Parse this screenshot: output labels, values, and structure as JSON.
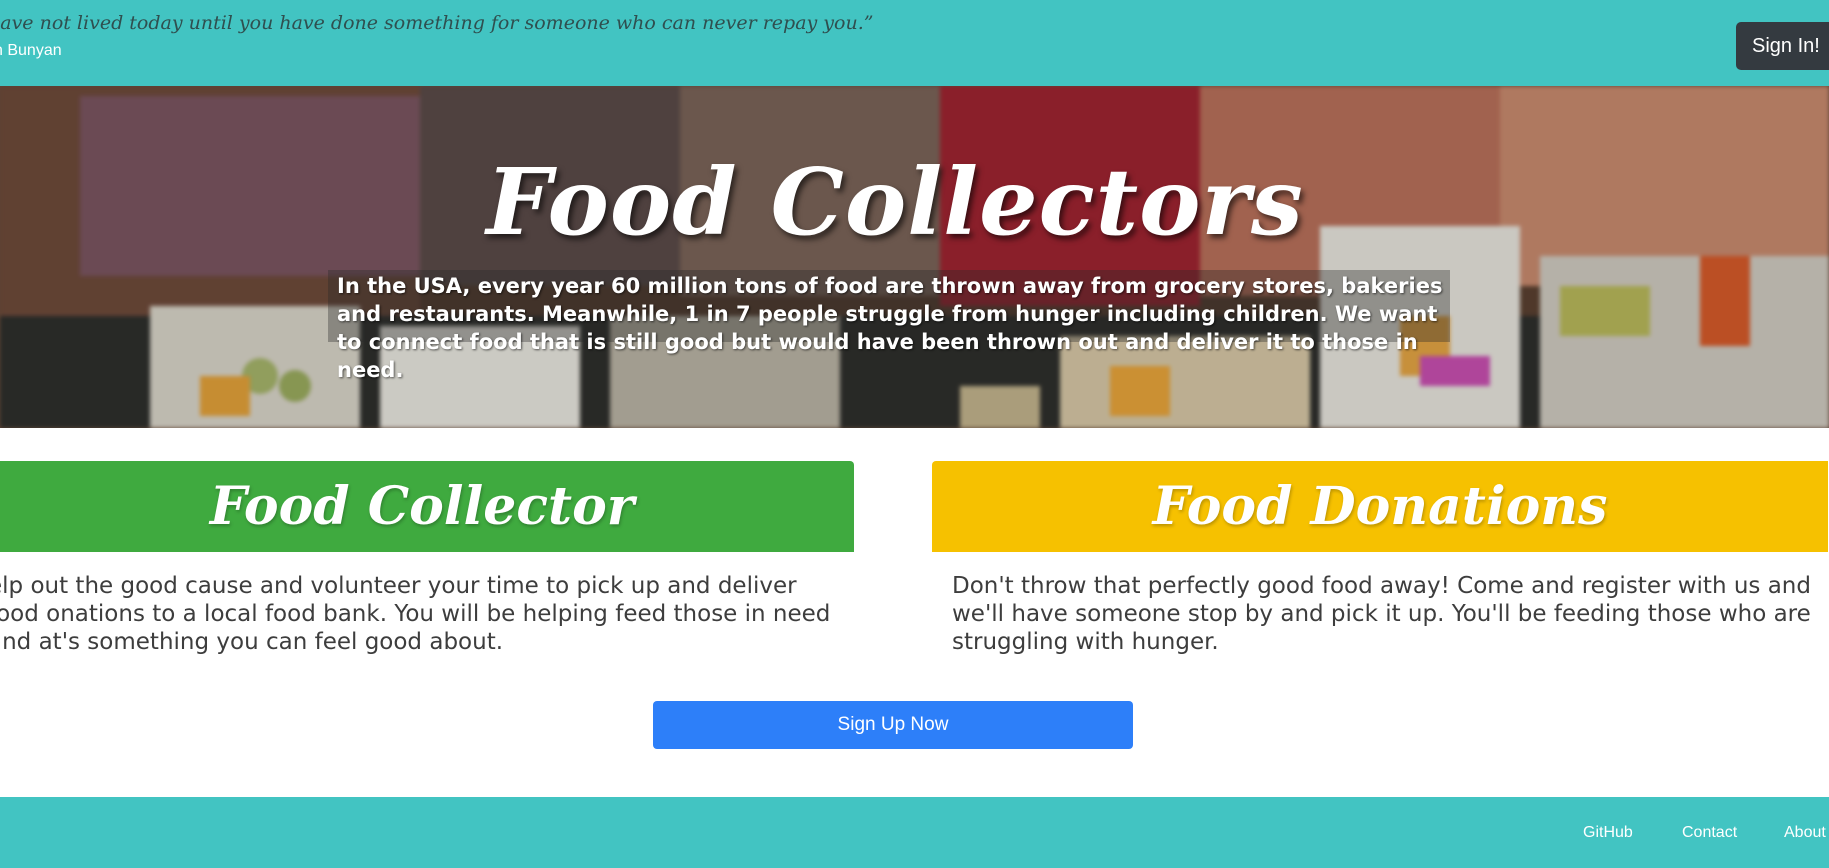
{
  "header": {
    "quote": "have not lived today until you have done something for someone who can never repay you.”",
    "quote_author": "n Bunyan",
    "signin_label": "Sign In!"
  },
  "hero": {
    "title": "Food Collectors",
    "description": "In the USA, every year 60 million tons of food are thrown away from grocery stores, bakeries and restaurants. Meanwhile, 1 in 7 people struggle from hunger including children. We want to connect food that is still good but would have been thrown out and deliver it to those in need.",
    "background_image": "children-eating-lunch-photo"
  },
  "cards": [
    {
      "title": "Food Collector",
      "body": "elp out the good cause and volunteer your time to pick up and deliver food onations to a local food bank. You will be helping feed those in need and at's something you can feel good about.",
      "color": "#3faa3f"
    },
    {
      "title": "Food Donations",
      "body": "Don't throw that perfectly good food away! Come and register with us and we'll have someone stop by and pick it up. You'll be feeding those who are struggling with hunger.",
      "color": "#f6c100"
    }
  ],
  "signup_label": "Sign Up Now",
  "footer": {
    "links": [
      "GitHub",
      "Contact",
      "About"
    ]
  },
  "colors": {
    "teal": "#42c4c2",
    "dark_button": "#343a40",
    "primary_button": "#2d7ff9"
  }
}
